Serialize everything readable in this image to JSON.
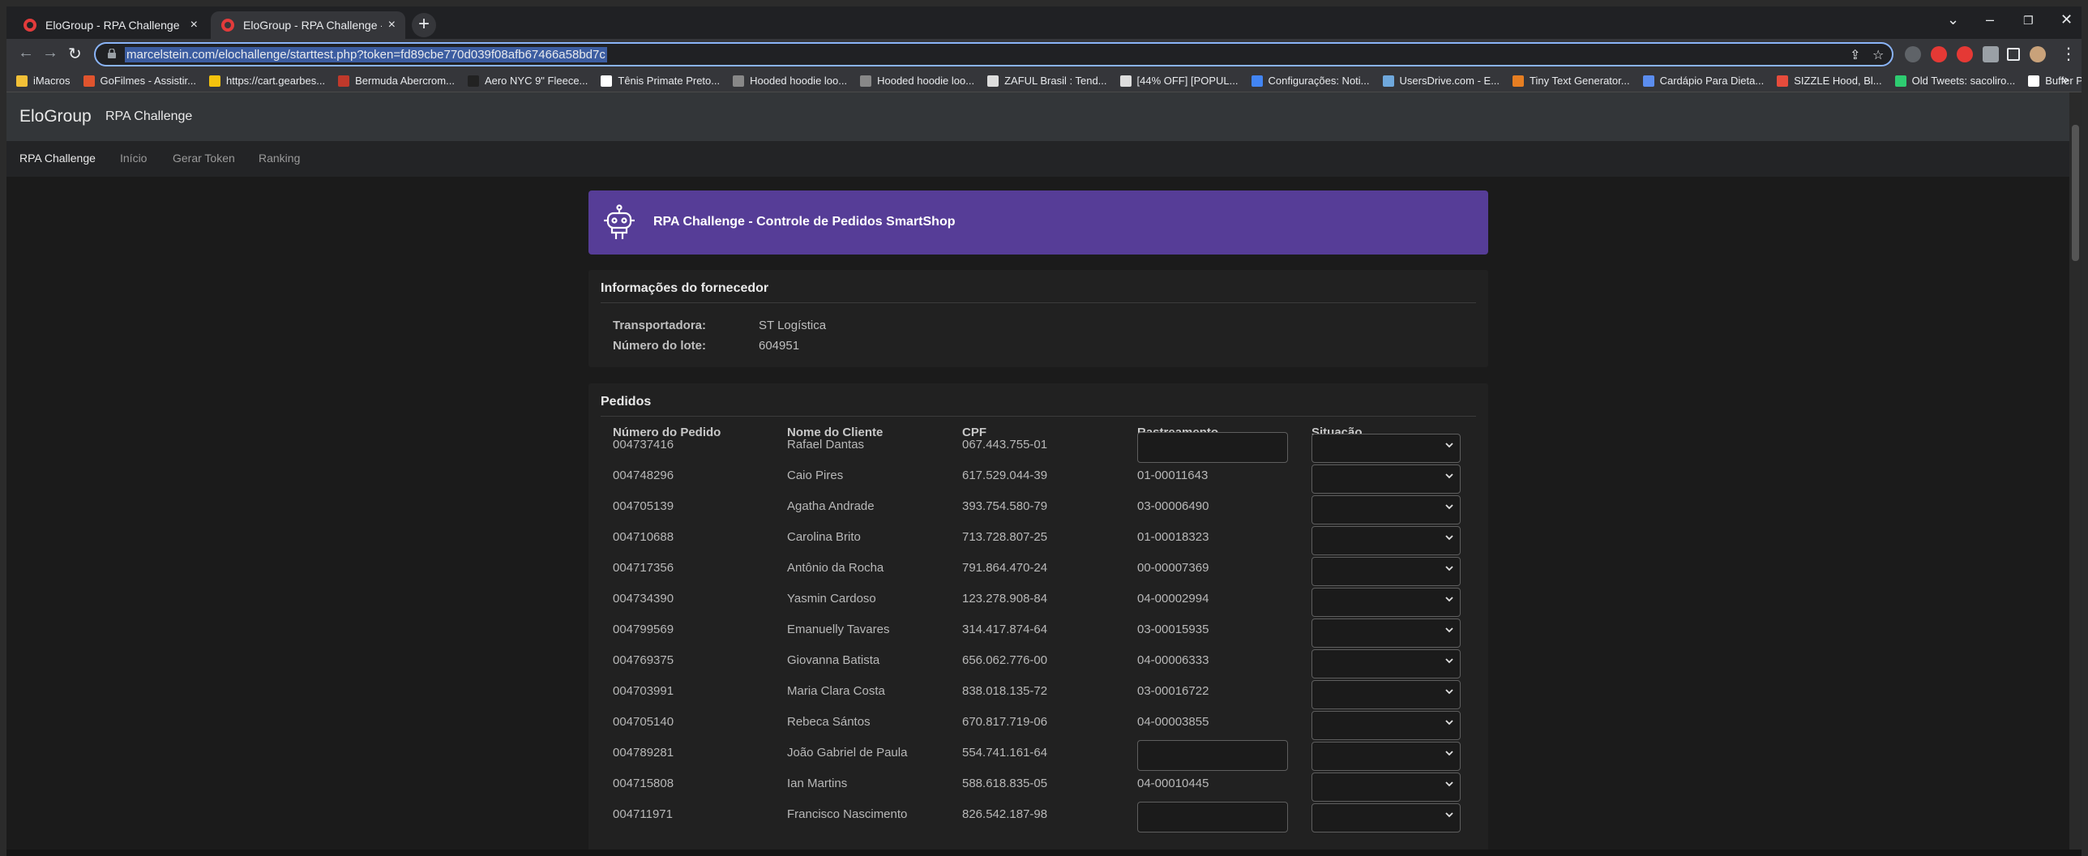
{
  "browser": {
    "tabs": [
      {
        "title": "EloGroup - RPA Challenge",
        "active": false
      },
      {
        "title": "EloGroup - RPA Challenge - Contr",
        "active": true
      }
    ],
    "url": "marcelstein.com/elochallenge/starttest.php?token=fd89cbe770d039f08afb67466a58bd7c",
    "bookmarks": [
      {
        "label": "iMacros",
        "color": "#f2c037"
      },
      {
        "label": "GoFilmes - Assistir...",
        "color": "#e0542e"
      },
      {
        "label": "https://cart.gearbes...",
        "color": "#f4c20d"
      },
      {
        "label": "Bermuda Abercrom...",
        "color": "#c0392b"
      },
      {
        "label": "Aero NYC 9\" Fleece...",
        "color": "#222"
      },
      {
        "label": "Tênis Primate Preto...",
        "color": "#ffffff"
      },
      {
        "label": "Hooded hoodie loo...",
        "color": "#888888"
      },
      {
        "label": "Hooded hoodie loo...",
        "color": "#888888"
      },
      {
        "label": "ZAFUL Brasil : Tend...",
        "color": "#dddddd"
      },
      {
        "label": "[44% OFF] [POPUL...",
        "color": "#dddddd"
      },
      {
        "label": "Configurações: Noti...",
        "color": "#4285f4"
      },
      {
        "label": "UsersDrive.com - E...",
        "color": "#6fa8dc"
      },
      {
        "label": "Tiny Text Generator...",
        "color": "#e67e22"
      },
      {
        "label": "Cardápio Para Dieta...",
        "color": "#5b8def"
      },
      {
        "label": "SIZZLE Hood, Bl...",
        "color": "#e74c3c"
      },
      {
        "label": "Old Tweets: sacoliro...",
        "color": "#2ecc71"
      },
      {
        "label": "Buffer Publish",
        "color": "#ffffff"
      }
    ]
  },
  "navbar": {
    "brand": "EloGroup",
    "subtitle": "RPA Challenge",
    "links": [
      "RPA Challenge",
      "Início",
      "Gerar Token",
      "Ranking"
    ]
  },
  "banner": {
    "title": "RPA Challenge - Controle de Pedidos SmartShop"
  },
  "supplier": {
    "heading": "Informações do fornecedor",
    "carrier_label": "Transportadora:",
    "carrier_value": "ST Logística",
    "batch_label": "Número do lote:",
    "batch_value": "604951"
  },
  "orders": {
    "heading": "Pedidos",
    "columns": [
      "Número do Pedido",
      "Nome do Cliente",
      "CPF",
      "Rastreamento",
      "Situação"
    ],
    "rows": [
      {
        "order": "004737416",
        "name": "Rafael Dantas",
        "cpf": "067.443.755-01",
        "tracking": "",
        "tracking_input": true
      },
      {
        "order": "004748296",
        "name": "Caio Pires",
        "cpf": "617.529.044-39",
        "tracking": "01-00011643",
        "tracking_input": false
      },
      {
        "order": "004705139",
        "name": "Agatha Andrade",
        "cpf": "393.754.580-79",
        "tracking": "03-00006490",
        "tracking_input": false
      },
      {
        "order": "004710688",
        "name": "Carolina Brito",
        "cpf": "713.728.807-25",
        "tracking": "01-00018323",
        "tracking_input": false
      },
      {
        "order": "004717356",
        "name": "Antônio da Rocha",
        "cpf": "791.864.470-24",
        "tracking": "00-00007369",
        "tracking_input": false
      },
      {
        "order": "004734390",
        "name": "Yasmin Cardoso",
        "cpf": "123.278.908-84",
        "tracking": "04-00002994",
        "tracking_input": false
      },
      {
        "order": "004799569",
        "name": "Emanuelly Tavares",
        "cpf": "314.417.874-64",
        "tracking": "03-00015935",
        "tracking_input": false
      },
      {
        "order": "004769375",
        "name": "Giovanna Batista",
        "cpf": "656.062.776-00",
        "tracking": "04-00006333",
        "tracking_input": false
      },
      {
        "order": "004703991",
        "name": "Maria Clara Costa",
        "cpf": "838.018.135-72",
        "tracking": "03-00016722",
        "tracking_input": false
      },
      {
        "order": "004705140",
        "name": "Rebeca Sántos",
        "cpf": "670.817.719-06",
        "tracking": "04-00003855",
        "tracking_input": false
      },
      {
        "order": "004789281",
        "name": "João Gabriel de Paula",
        "cpf": "554.741.161-64",
        "tracking": "",
        "tracking_input": true
      },
      {
        "order": "004715808",
        "name": "Ian Martins",
        "cpf": "588.618.835-05",
        "tracking": "04-00010445",
        "tracking_input": false
      },
      {
        "order": "004711971",
        "name": "Francisco Nascimento",
        "cpf": "826.542.187-98",
        "tracking": "",
        "tracking_input": true
      }
    ]
  },
  "colors": {
    "banner": "#563d97",
    "page_bg": "#1b1b1b",
    "navbar": "#333639"
  }
}
